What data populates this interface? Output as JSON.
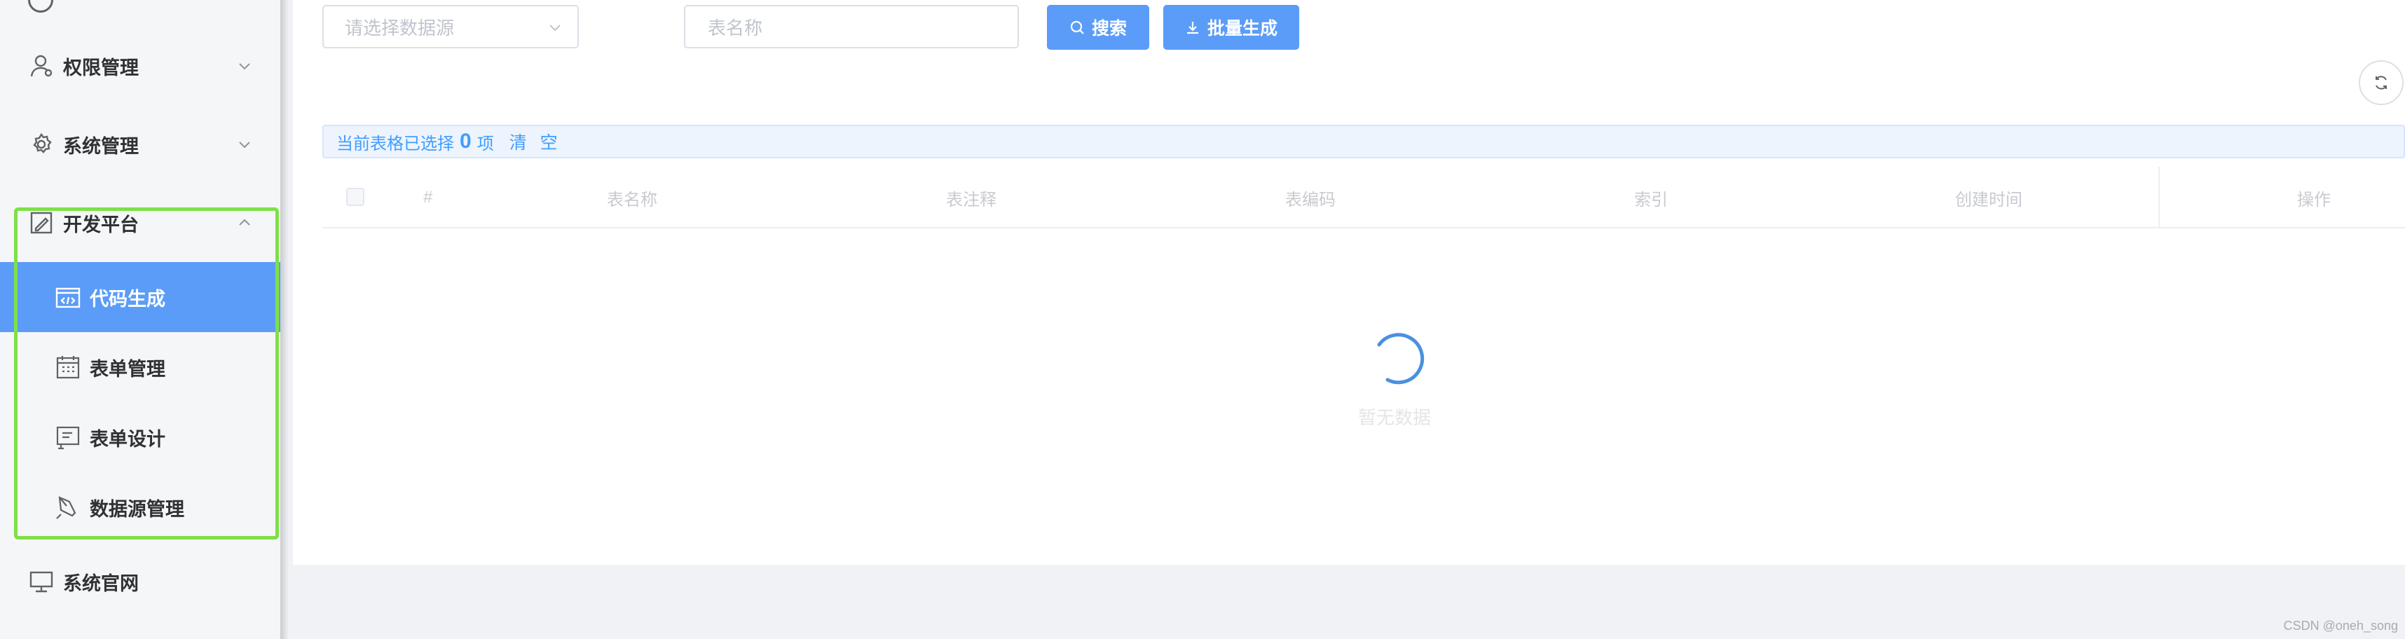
{
  "sidebar": {
    "items": [
      {
        "label": "权限管理",
        "icon": "user-icon"
      },
      {
        "label": "系统管理",
        "icon": "gear-icon"
      },
      {
        "label": "开发平台",
        "icon": "edit-icon",
        "expanded": true
      },
      {
        "label": "代码生成",
        "icon": "code-window-icon",
        "active": true
      },
      {
        "label": "表单管理",
        "icon": "calendar-icon"
      },
      {
        "label": "表单设计",
        "icon": "form-design-icon"
      },
      {
        "label": "数据源管理",
        "icon": "pen-icon"
      },
      {
        "label": "系统官网",
        "icon": "monitor-icon"
      }
    ]
  },
  "toolbar": {
    "datasource_placeholder": "请选择数据源",
    "tablename_placeholder": "表名称",
    "search_label": "搜索",
    "batch_label": "批量生成"
  },
  "selection": {
    "prefix": "当前表格已选择",
    "count": "0",
    "suffix": "项",
    "clear_label": "清 空"
  },
  "table": {
    "columns": [
      "#",
      "表名称",
      "表注释",
      "表编码",
      "索引",
      "创建时间",
      "操作"
    ]
  },
  "empty_text": "暂无数据",
  "watermark": "CSDN @oneh_song",
  "colors": {
    "primary": "#5b9cf8",
    "highlight_border": "#7ee048",
    "selection_bg": "#edf4fe"
  }
}
